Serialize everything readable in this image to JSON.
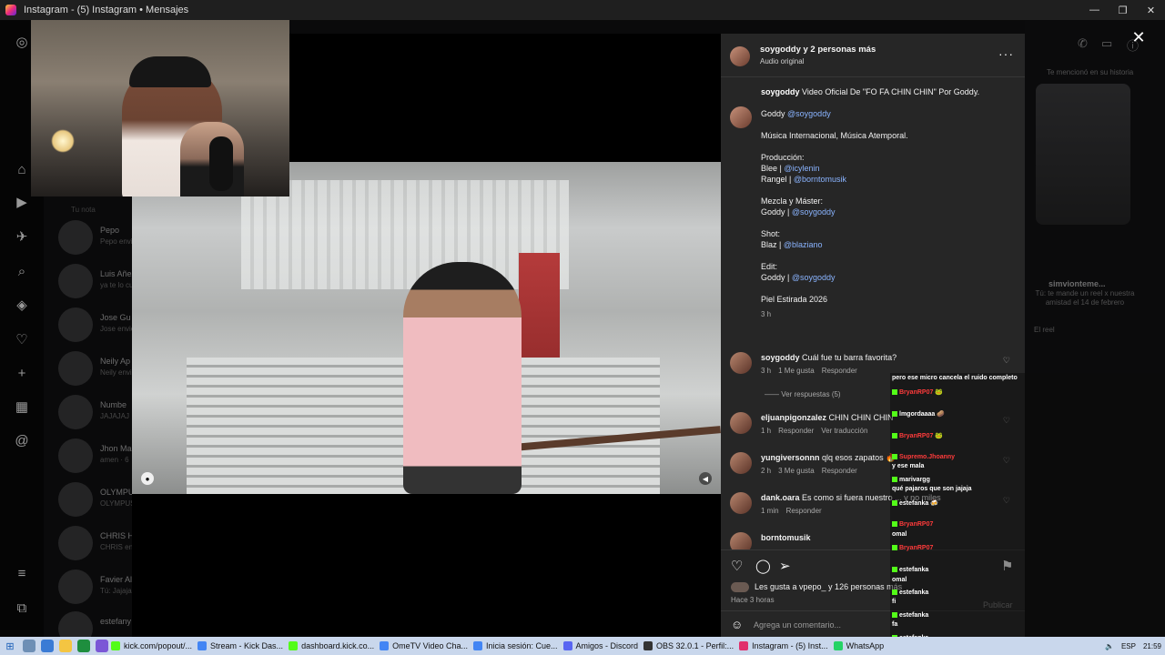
{
  "window": {
    "title": "Instagram - (5) Instagram • Mensajes",
    "minimize": "—",
    "restore": "❐",
    "close": "✕"
  },
  "dm_list": {
    "tab_label": "Tu nota",
    "items": [
      {
        "name": "Pepo",
        "preview": "Pepo envió"
      },
      {
        "name": "Luis Añez",
        "preview": "ya te lo cue"
      },
      {
        "name": "Jose Gu",
        "preview": "Jose envió"
      },
      {
        "name": "Neily Ap",
        "preview": "Neily envió"
      },
      {
        "name": "Numbe",
        "preview": "JAJAJAJ"
      },
      {
        "name": "Jhon Ma",
        "preview": "amen · 6"
      },
      {
        "name": "OLYMPU",
        "preview": "OLYMPUS"
      },
      {
        "name": "CHRIS H",
        "preview": "CHRIS envi"
      },
      {
        "name": "Favier Al",
        "preview": "Tú: Jajaja"
      },
      {
        "name": "estefany villarrobos",
        "preview": ""
      }
    ]
  },
  "post": {
    "header_user": "soygoddy y 2 personas más",
    "header_audio": "Audio original",
    "more": "···",
    "caption_user": "soygoddy",
    "caption_lines": [
      "Video Oficial De \"FO FA CHIN CHIN\" Por Goddy.",
      "Goddy @soygoddy",
      "Música Internacional, Música Atemporal.",
      "Producción:\nBlee | @icylenin\nRangel | @borntomusik",
      "Mezcla y Máster:\nGoddy | @soygoddy",
      "Shot:\nBlaz | @blaziano",
      "Edit:\nGoddy | @soygoddy",
      "Piel Estirada 2026"
    ],
    "caption_time": "3 h",
    "comments": [
      {
        "user": "soygoddy",
        "text": "Cuál fue tu barra favorita?",
        "time": "3 h",
        "likes": "1 Me gusta",
        "reply": "Responder",
        "extra": ""
      },
      {
        "user": "eljuanpigonzalez",
        "text": "CHIN CHIN CHIN",
        "time": "1 h",
        "likes": "",
        "reply": "Responder",
        "extra": "Ver traducción"
      },
      {
        "user": "yungiversonnn",
        "text": "qlq esos zapatos 🔥",
        "time": "2 h",
        "likes": "3 Me gusta",
        "reply": "Responder",
        "extra": ""
      },
      {
        "user": "dank.oara",
        "text": "Es como si fuera nuestro ... y no miles",
        "time": "1 min",
        "likes": "",
        "reply": "Responder",
        "extra": ""
      },
      {
        "user": "borntomusik",
        "text": "",
        "time": "",
        "likes": "",
        "reply": "",
        "extra": ""
      }
    ],
    "view_replies": "Ver respuestas (5)",
    "likes_text": "Les gusta a vpepo_ y 126 personas más",
    "likes_user": "vpepo_",
    "time_ago": "Hace 3 horas",
    "add_comment_placeholder": "Agrega un comentario...",
    "publish": "Publicar"
  },
  "right_panel": {
    "note": "Te mencionó en su historia",
    "user": "simvionteme...",
    "message": "Tú: te mande un reel x nuestra amistad el 14 de febrero",
    "reel": "El reel"
  },
  "stream_chat": [
    {
      "user": "",
      "msg": "pero ese micro cancela el ruido completo"
    },
    {
      "user": "BryanRP07",
      "msg": "🐸"
    },
    {
      "user": "lmgordaaaa",
      "msg": "🥔"
    },
    {
      "user": "BryanRP07",
      "msg": "🐸"
    },
    {
      "user": "Supremo.Jhoanny",
      "msg": ""
    },
    {
      "user": "",
      "msg": "y ese mala"
    },
    {
      "user": "marivargg",
      "msg": ""
    },
    {
      "user": "",
      "msg": "qué pajaros que son jajaja"
    },
    {
      "user": "estefanka",
      "msg": "🍻"
    },
    {
      "user": "BryanRP07",
      "msg": ""
    },
    {
      "user": "",
      "msg": "omal"
    },
    {
      "user": "BryanRP07",
      "msg": ""
    },
    {
      "user": "estefanka",
      "msg": ""
    },
    {
      "user": "",
      "msg": "omal"
    },
    {
      "user": "estefanka",
      "msg": "fi"
    },
    {
      "user": "estefanka",
      "msg": "fa"
    },
    {
      "user": "estefanka",
      "msg": ""
    }
  ],
  "taskbar": {
    "apps": [
      {
        "label": "kick.com/popout/...",
        "color": "#53fc18"
      },
      {
        "label": "Stream - Kick Das...",
        "color": "#4285f4"
      },
      {
        "label": "dashboard.kick.co...",
        "color": "#53fc18"
      },
      {
        "label": "OmeTV Video Cha...",
        "color": "#4285f4"
      },
      {
        "label": "Inicia sesión: Cue...",
        "color": "#4285f4"
      },
      {
        "label": "Amigos - Discord",
        "color": "#5865f2"
      },
      {
        "label": "OBS 32.0.1 - Perfil:...",
        "color": "#333333"
      },
      {
        "label": "Instagram - (5) Inst...",
        "color": "#e1306c"
      },
      {
        "label": "WhatsApp",
        "color": "#25d366"
      }
    ],
    "lang": "ESP",
    "time": "21:59"
  }
}
